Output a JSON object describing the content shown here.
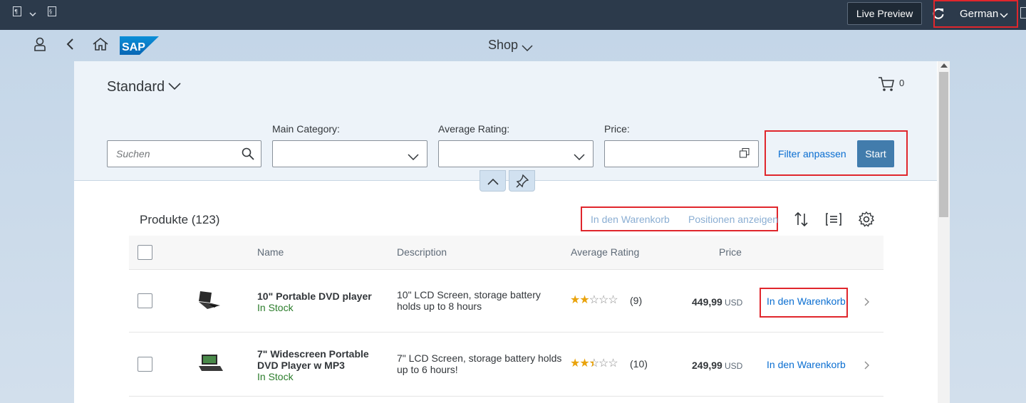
{
  "topbar": {
    "live_preview": "Live Preview",
    "language": "German"
  },
  "shell": {
    "logo": "SAP",
    "title": "Shop"
  },
  "filterbar": {
    "variant": "Standard",
    "cart_count": "0",
    "search_placeholder": "Suchen",
    "labels": {
      "main_category": "Main Category:",
      "average_rating": "Average Rating:",
      "price": "Price:"
    },
    "adapt_filters": "Filter anpassen",
    "start": "Start"
  },
  "table": {
    "title": "Produkte (123)",
    "toolbar": {
      "add_to_cart": "In den Warenkorb",
      "show_items": "Positionen anzeigen"
    },
    "columns": {
      "name": "Name",
      "description": "Description",
      "rating": "Average Rating",
      "price": "Price"
    },
    "rows": [
      {
        "name": "10\" Portable DVD player",
        "stock": "In Stock",
        "description": "10\" LCD Screen, storage battery holds up to 8 hours",
        "rating": 2,
        "rating_count": "(9)",
        "price": "449,99",
        "currency": "USD",
        "action": "In den Warenkorb"
      },
      {
        "name": "7\" Widescreen Portable DVD Player w MP3",
        "stock": "In Stock",
        "description": "7\" LCD Screen, storage battery holds up to 6 hours!",
        "rating": 2.5,
        "rating_count": "(10)",
        "price": "249,99",
        "currency": "USD",
        "action": "In den Warenkorb"
      }
    ]
  }
}
